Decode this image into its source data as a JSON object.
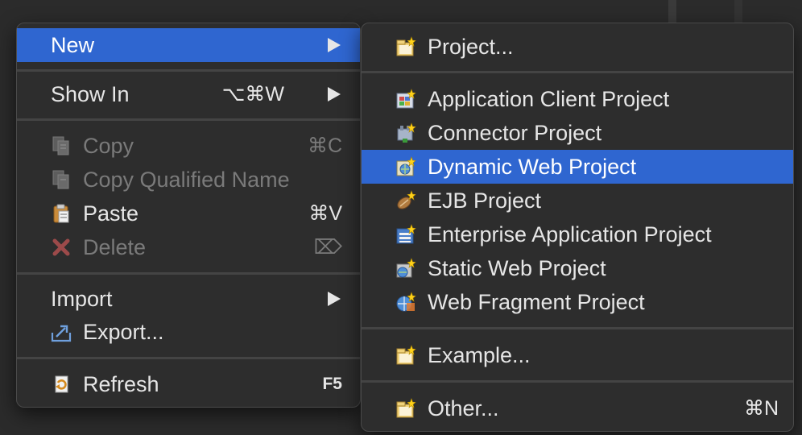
{
  "main_menu": {
    "items": [
      {
        "label": "New",
        "icon": "none",
        "submenu": true
      },
      {
        "label": "Show In",
        "shortcut": "⌥⌘W",
        "submenu": true
      },
      {
        "label": "Copy",
        "shortcut": "⌘C",
        "icon": "copy-icon",
        "disabled": true
      },
      {
        "label": "Copy Qualified Name",
        "icon": "copy-qualified-name-icon",
        "disabled": true
      },
      {
        "label": "Paste",
        "shortcut": "⌘V",
        "icon": "paste-icon"
      },
      {
        "label": "Delete",
        "shortcut": "⌦",
        "icon": "delete-icon",
        "disabled": true
      },
      {
        "label": "Import",
        "submenu": true
      },
      {
        "label": "Export...",
        "icon": "export-icon"
      },
      {
        "label": "Refresh",
        "shortcut": "F5",
        "icon": "refresh-icon"
      }
    ]
  },
  "new_submenu": {
    "items": [
      {
        "label": "Project...",
        "icon": "new-project-icon"
      },
      {
        "label": "Application Client Project",
        "icon": "application-client-project-icon"
      },
      {
        "label": "Connector Project",
        "icon": "connector-project-icon"
      },
      {
        "label": "Dynamic Web Project",
        "icon": "dynamic-web-project-icon",
        "selected": true
      },
      {
        "label": "EJB Project",
        "icon": "ejb-project-icon"
      },
      {
        "label": "Enterprise Application Project",
        "icon": "enterprise-application-project-icon"
      },
      {
        "label": "Static Web Project",
        "icon": "static-web-project-icon"
      },
      {
        "label": "Web Fragment Project",
        "icon": "web-fragment-project-icon"
      },
      {
        "label": "Example...",
        "icon": "example-icon"
      },
      {
        "label": "Other...",
        "shortcut": "⌘N",
        "icon": "other-icon"
      }
    ]
  },
  "colors": {
    "menu_bg": "#2d2d2d",
    "selection": "#2f66d0",
    "text": "#e6e6e6",
    "disabled_text": "#7a7a7a"
  }
}
